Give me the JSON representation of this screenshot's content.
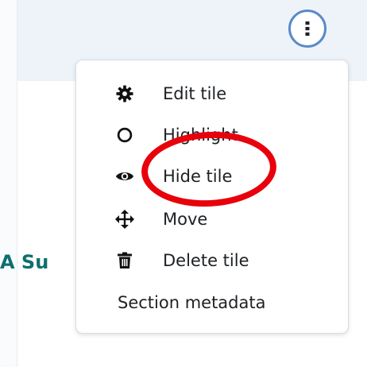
{
  "header": {
    "actions_icon": "kebab-vertical-icon"
  },
  "section": {
    "partial_title": "A Su"
  },
  "menu": {
    "items": [
      {
        "label": "Edit tile",
        "icon": "gear-icon"
      },
      {
        "label": "Highlight",
        "icon": "circle-outline-icon"
      },
      {
        "label": "Hide tile",
        "icon": "eye-icon"
      },
      {
        "label": "Move",
        "icon": "move-arrows-icon"
      },
      {
        "label": "Delete tile",
        "icon": "trash-icon"
      },
      {
        "label": "Section metadata",
        "icon": ""
      }
    ]
  },
  "colors": {
    "menu_text": "#1d2125",
    "button_ring": "#5a8ac8",
    "header_band": "#eef3fa",
    "heading_teal": "#0f6f6f",
    "annotation_red": "#e8000b"
  }
}
